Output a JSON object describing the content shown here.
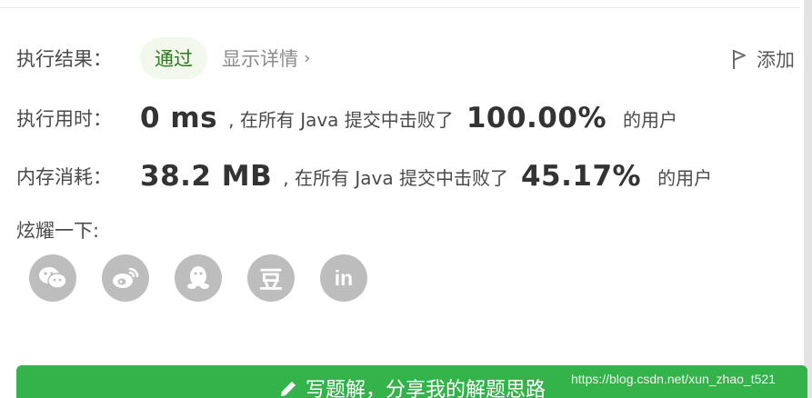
{
  "result": {
    "label": "执行结果：",
    "status": "通过",
    "detail_link": "显示详情",
    "add_note": "添加"
  },
  "runtime": {
    "label": "执行用时：",
    "value": "0 ms",
    "text": ", 在所有 Java 提交中击败了",
    "percent": "100.00%",
    "suffix": "的用户"
  },
  "memory": {
    "label": "内存消耗：",
    "value": "38.2 MB",
    "text": ", 在所有 Java 提交中击败了",
    "percent": "45.17%",
    "suffix": "的用户"
  },
  "share": {
    "label": "炫耀一下:",
    "icons": [
      "wechat-icon",
      "weibo-icon",
      "qq-icon",
      "douban-icon",
      "linkedin-icon"
    ],
    "douban_glyph": "豆",
    "linkedin_glyph": "in"
  },
  "write_solution": {
    "label": "写题解，分享我的解题思路"
  },
  "watermark": "https://blog.csdn.net/xun_zhao_t521",
  "colors": {
    "accent_green": "#34b34a",
    "pass_text": "#2b7a1f",
    "pass_bg": "#f2f8ec",
    "icon_gray": "#bdbdbd"
  }
}
